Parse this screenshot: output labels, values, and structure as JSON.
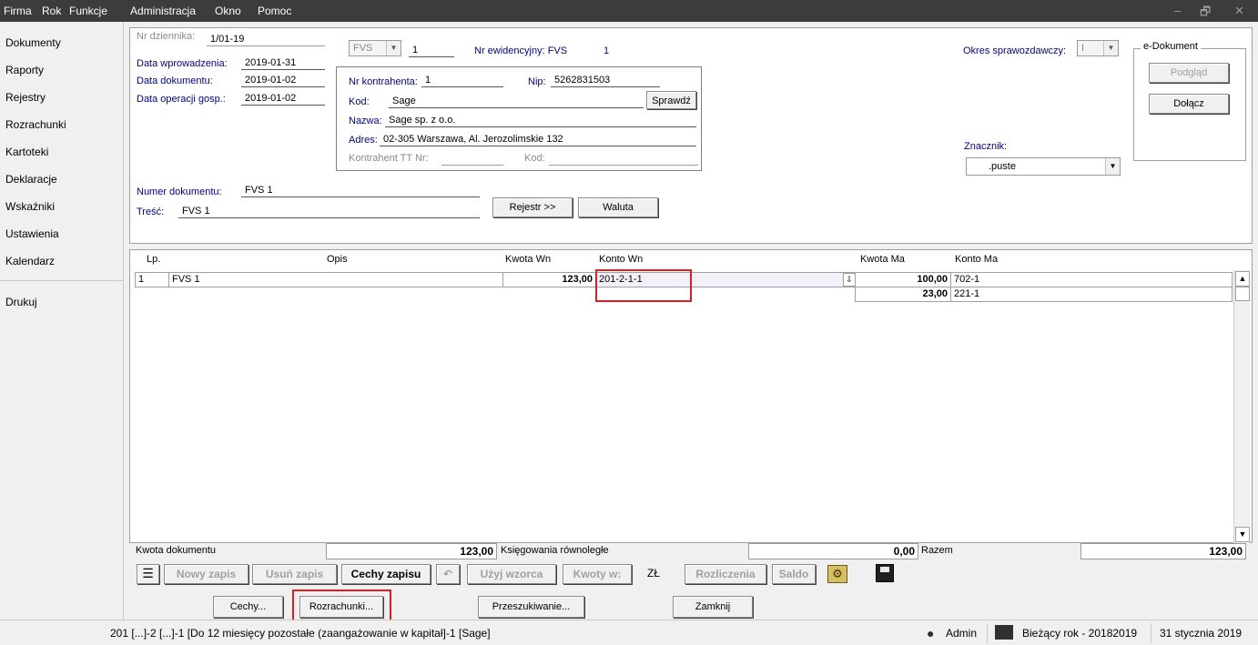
{
  "menu": [
    "Firma",
    "Rok",
    "Funkcje",
    "Administracja",
    "Okno",
    "Pomoc"
  ],
  "window_controls": {
    "minimize": "–",
    "restore": "🗗",
    "close": "✕"
  },
  "sidebar": {
    "items": [
      "Dokumenty",
      "Raporty",
      "Rejestry",
      "Rozrachunki",
      "Kartoteki",
      "Deklaracje",
      "Wskaźniki",
      "Ustawienia",
      "Kalendarz",
      "Drukuj"
    ]
  },
  "header": {
    "nr_dziennika_label": "Nr dziennika:",
    "nr_dziennika": "1/01-19",
    "data_wprowadzenia_label": "Data wprowadzenia:",
    "data_wprowadzenia": "2019-01-31",
    "data_dokumentu_label": "Data dokumentu:",
    "data_dokumentu": "2019-01-02",
    "data_operacji_label": "Data operacji gosp.:",
    "data_operacji": "2019-01-02",
    "doc_type": "FVS",
    "doc_number": "1",
    "nr_ewidencyjny_label": "Nr ewidencyjny: FVS",
    "nr_ewidencyjny": "1",
    "okres_label": "Okres sprawozdawczy:",
    "okres_value": "I",
    "numer_dokumentu_label": "Numer dokumentu:",
    "numer_dokumentu": "FVS 1",
    "tresc_label": "Treść:",
    "tresc": "FVS 1",
    "rejestr_btn": "Rejestr >>",
    "waluta_btn": "Waluta",
    "znacznik_label": "Znacznik:",
    "znacznik_value": ".puste"
  },
  "contractor": {
    "nr_label": "Nr kontrahenta:",
    "nr": "1",
    "nip_label": "Nip:",
    "nip": "5262831503",
    "kod_label": "Kod:",
    "kod": "Sage",
    "sprawdz_btn": "Sprawdź",
    "nazwa_label": "Nazwa:",
    "nazwa": "Sage sp. z o.o.",
    "adres_label": "Adres:",
    "adres": "02-305 Warszawa, Al. Jerozolimskie 132",
    "tt_label": "Kontrahent TT Nr:",
    "tt_kod_label": "Kod:"
  },
  "edokument": {
    "title": "e-Dokument",
    "podglad_btn": "Podgląd",
    "dolacz_btn": "Dołącz"
  },
  "grid": {
    "columns": [
      "Lp.",
      "Opis",
      "Kwota Wn",
      "Konto Wn",
      "Kwota Ma",
      "Konto Ma"
    ],
    "rows": [
      {
        "lp": "1",
        "opis": "FVS 1",
        "kwota_wn": "123,00",
        "konto_wn": "201-2-1-1",
        "kwota_ma": "100,00",
        "konto_ma": "702-1"
      },
      {
        "lp": "",
        "opis": "",
        "kwota_wn": "",
        "konto_wn": "",
        "kwota_ma": "23,00",
        "konto_ma": "221-1"
      }
    ]
  },
  "totals": {
    "kwota_dokumentu_label": "Kwota dokumentu",
    "kwota_dokumentu": "123,00",
    "ksiegowania_label": "Księgowania równoległe",
    "ksiegowania": "0,00",
    "razem_label": "Razem",
    "razem": "123,00"
  },
  "toolbar": {
    "nowy_zapis": "Nowy zapis",
    "usun_zapis": "Usuń zapis",
    "cechy_zapisu": "Cechy zapisu",
    "uzyj_wzorca": "Użyj wzorca",
    "kwoty_w": "Kwoty w:",
    "currency": "ZŁ",
    "rozliczenia": "Rozliczenia",
    "saldo": "Saldo"
  },
  "bottom_buttons": {
    "cechy": "Cechy...",
    "rozrachunki": "Rozrachunki...",
    "przeszukiwanie": "Przeszukiwanie...",
    "zamknij": "Zamknij"
  },
  "status": {
    "account_desc": "201 [...]-2 [...]-1 [Do 12 miesięcy pozostałe (zaangażowanie w kapitał]-1 [Sage]",
    "user": "Admin",
    "year": "Bieżący rok - 20182019",
    "date": "31 stycznia 2019"
  }
}
